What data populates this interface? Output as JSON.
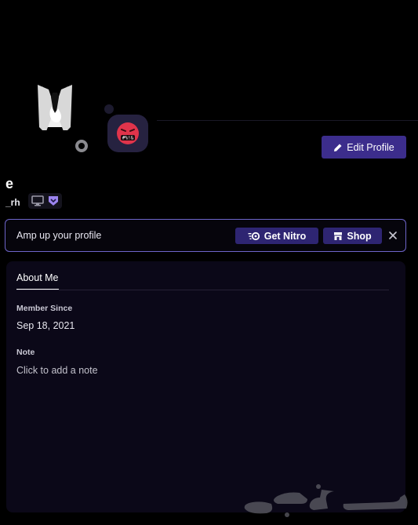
{
  "profile": {
    "display_name": "e",
    "username": "_rh",
    "avatar_icon": "tuxedo-figure-icon",
    "status": "idle",
    "status_color": "#8a8a8f",
    "custom_status_emoji": "cursing-face-icon",
    "edit_label": "Edit Profile"
  },
  "badges": [
    {
      "name": "desktop-icon"
    },
    {
      "name": "hypesquad-badge-icon"
    }
  ],
  "nitro_banner": {
    "text": "Amp up your profile",
    "get_nitro_label": "Get Nitro",
    "shop_label": "Shop"
  },
  "about": {
    "tab_label": "About Me",
    "member_since_heading": "Member Since",
    "member_since_value": "Sep 18, 2021",
    "note_heading": "Note",
    "note_placeholder": "Click to add a note"
  },
  "colors": {
    "accent": "#3c2d8c",
    "card_bg": "#0b0818",
    "banner_border": "#6d64c8"
  }
}
